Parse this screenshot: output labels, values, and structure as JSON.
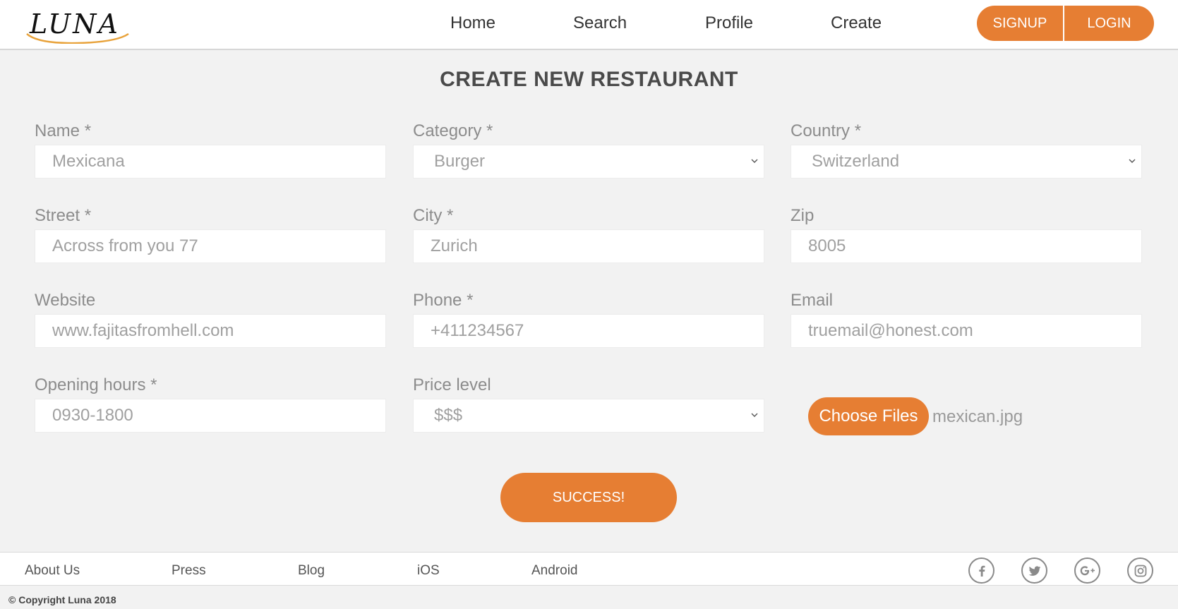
{
  "header": {
    "logo_text": "LUNA",
    "nav": [
      "Home",
      "Search",
      "Profile",
      "Create"
    ],
    "signup_label": "SIGNUP",
    "login_label": "LOGIN"
  },
  "page": {
    "title": "CREATE NEW RESTAURANT"
  },
  "form": {
    "name": {
      "label": "Name *",
      "value": "Mexicana"
    },
    "category": {
      "label": "Category *",
      "value": "Burger"
    },
    "country": {
      "label": "Country *",
      "value": "Switzerland"
    },
    "street": {
      "label": "Street *",
      "value": "Across from you 77"
    },
    "city": {
      "label": "City *",
      "value": "Zurich"
    },
    "zip": {
      "label": "Zip",
      "value": "8005"
    },
    "website": {
      "label": "Website",
      "value": "www.fajitasfromhell.com"
    },
    "phone": {
      "label": "Phone *",
      "value": "+411234567"
    },
    "email": {
      "label": "Email",
      "value": "truemail@honest.com"
    },
    "opening_hours": {
      "label": "Opening hours *",
      "value": "0930-1800"
    },
    "price_level": {
      "label": "Price level",
      "value": "$$$"
    },
    "choose_files_label": "Choose Files",
    "file_name": "mexican.jpg",
    "submit_label": "SUCCESS!"
  },
  "footer": {
    "links": [
      "About Us",
      "Press",
      "Blog",
      "iOS",
      "Android"
    ],
    "social_icons": [
      "facebook-icon",
      "twitter-icon",
      "google-plus-icon",
      "instagram-icon"
    ],
    "copyright": "© Copyright Luna 2018"
  },
  "colors": {
    "accent": "#e67e33",
    "background": "#f2f2f2",
    "label": "#8c8c8c"
  }
}
